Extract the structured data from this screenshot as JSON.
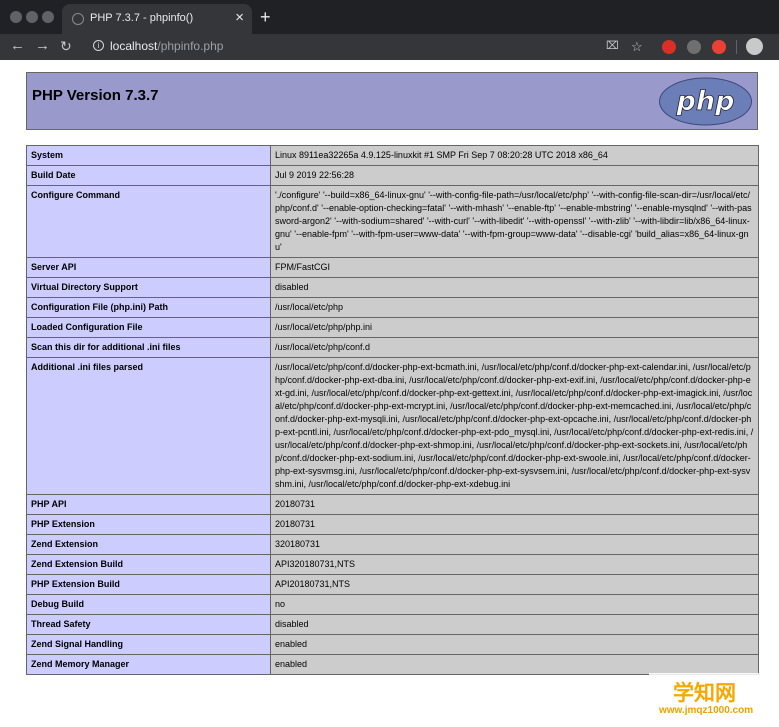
{
  "browser": {
    "tab_title": "PHP 7.3.7 - phpinfo()",
    "url_host": "localhost",
    "url_path": "/phpinfo.php"
  },
  "page": {
    "title": "PHP Version 7.3.7",
    "logo_text": "php"
  },
  "rows": [
    {
      "key": "System",
      "value": "Linux 8911ea32265a 4.9.125-linuxkit #1 SMP Fri Sep 7 08:20:28 UTC 2018 x86_64"
    },
    {
      "key": "Build Date",
      "value": "Jul 9 2019 22:56:28"
    },
    {
      "key": "Configure Command",
      "value": "'./configure' '--build=x86_64-linux-gnu' '--with-config-file-path=/usr/local/etc/php' '--with-config-file-scan-dir=/usr/local/etc/php/conf.d' '--enable-option-checking=fatal' '--with-mhash' '--enable-ftp' '--enable-mbstring' '--enable-mysqlnd' '--with-password-argon2' '--with-sodium=shared' '--with-curl' '--with-libedit' '--with-openssl' '--with-zlib' '--with-libdir=lib/x86_64-linux-gnu' '--enable-fpm' '--with-fpm-user=www-data' '--with-fpm-group=www-data' '--disable-cgi' 'build_alias=x86_64-linux-gnu'"
    },
    {
      "key": "Server API",
      "value": "FPM/FastCGI"
    },
    {
      "key": "Virtual Directory Support",
      "value": "disabled"
    },
    {
      "key": "Configuration File (php.ini) Path",
      "value": "/usr/local/etc/php"
    },
    {
      "key": "Loaded Configuration File",
      "value": "/usr/local/etc/php/php.ini"
    },
    {
      "key": "Scan this dir for additional .ini files",
      "value": "/usr/local/etc/php/conf.d"
    },
    {
      "key": "Additional .ini files parsed",
      "value": "/usr/local/etc/php/conf.d/docker-php-ext-bcmath.ini, /usr/local/etc/php/conf.d/docker-php-ext-calendar.ini, /usr/local/etc/php/conf.d/docker-php-ext-dba.ini, /usr/local/etc/php/conf.d/docker-php-ext-exif.ini, /usr/local/etc/php/conf.d/docker-php-ext-gd.ini, /usr/local/etc/php/conf.d/docker-php-ext-gettext.ini, /usr/local/etc/php/conf.d/docker-php-ext-imagick.ini, /usr/local/etc/php/conf.d/docker-php-ext-mcrypt.ini, /usr/local/etc/php/conf.d/docker-php-ext-memcached.ini, /usr/local/etc/php/conf.d/docker-php-ext-mysqli.ini, /usr/local/etc/php/conf.d/docker-php-ext-opcache.ini, /usr/local/etc/php/conf.d/docker-php-ext-pcntl.ini, /usr/local/etc/php/conf.d/docker-php-ext-pdo_mysql.ini, /usr/local/etc/php/conf.d/docker-php-ext-redis.ini, /usr/local/etc/php/conf.d/docker-php-ext-shmop.ini, /usr/local/etc/php/conf.d/docker-php-ext-sockets.ini, /usr/local/etc/php/conf.d/docker-php-ext-sodium.ini, /usr/local/etc/php/conf.d/docker-php-ext-swoole.ini, /usr/local/etc/php/conf.d/docker-php-ext-sysvmsg.ini, /usr/local/etc/php/conf.d/docker-php-ext-sysvsem.ini, /usr/local/etc/php/conf.d/docker-php-ext-sysvshm.ini, /usr/local/etc/php/conf.d/docker-php-ext-xdebug.ini"
    },
    {
      "key": "PHP API",
      "value": "20180731"
    },
    {
      "key": "PHP Extension",
      "value": "20180731"
    },
    {
      "key": "Zend Extension",
      "value": "320180731"
    },
    {
      "key": "Zend Extension Build",
      "value": "API320180731,NTS"
    },
    {
      "key": "PHP Extension Build",
      "value": "API20180731,NTS"
    },
    {
      "key": "Debug Build",
      "value": "no"
    },
    {
      "key": "Thread Safety",
      "value": "disabled"
    },
    {
      "key": "Zend Signal Handling",
      "value": "enabled"
    },
    {
      "key": "Zend Memory Manager",
      "value": "enabled"
    }
  ],
  "watermark": {
    "text": "学知网",
    "url": "www.jmqz1000.com"
  },
  "colors": {
    "header_bg": "#9999cc",
    "key_bg": "#ccccff",
    "value_bg": "#cccccc",
    "chrome_dark": "#202124"
  }
}
